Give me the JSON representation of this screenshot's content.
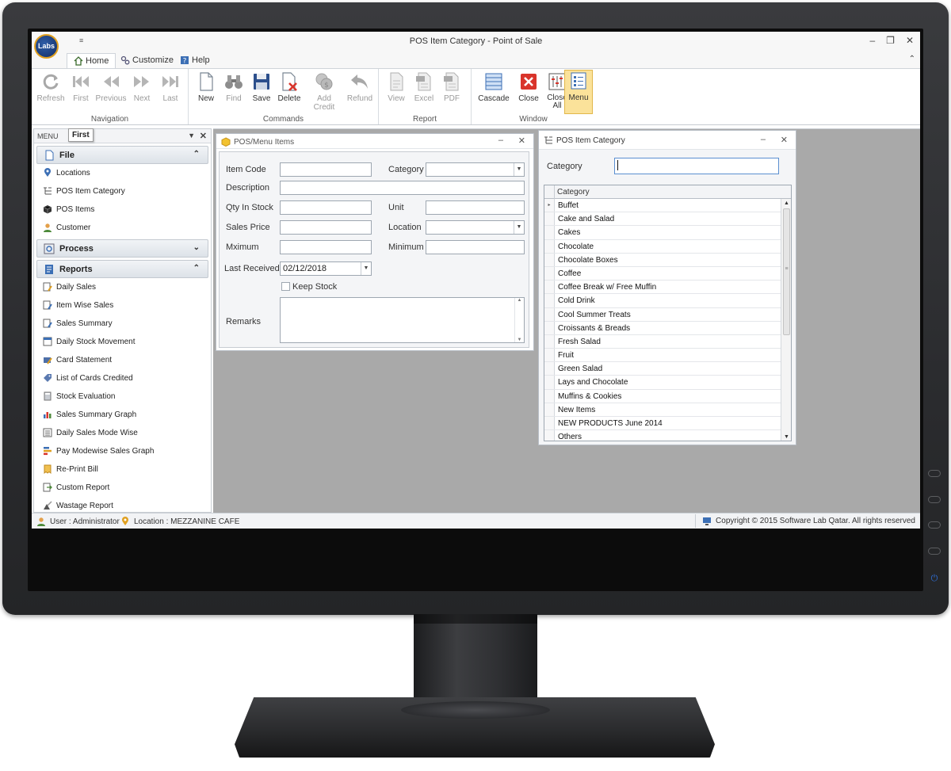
{
  "window": {
    "title": "POS Item Category - Point of Sale",
    "logo_text": "Labs",
    "qat_glyph": "≡",
    "controls": {
      "minimize": "🗕",
      "restore": "🗗",
      "close": "✕"
    }
  },
  "ribbon": {
    "tabs": [
      {
        "label": "Home",
        "icon": "home-icon"
      },
      {
        "label": "Customize",
        "icon": "gears-icon"
      },
      {
        "label": "Help",
        "icon": "help-icon"
      }
    ],
    "collapse_glyph": "⌃",
    "groups": {
      "navigation": {
        "label": "Navigation",
        "buttons": [
          "Refresh",
          "First",
          "Previous",
          "Next",
          "Last"
        ]
      },
      "commands": {
        "label": "Commands",
        "buttons": [
          "New",
          "Find",
          "Save",
          "Delete",
          "Add Credit",
          "Refund"
        ]
      },
      "report": {
        "label": "Report",
        "buttons": [
          "View",
          "Excel",
          "PDF"
        ]
      },
      "window": {
        "label": "Window",
        "buttons": [
          "Cascade",
          "Close",
          "Close All",
          "Menu"
        ],
        "close_all_line1": "Close",
        "close_all_line2": "All"
      }
    }
  },
  "left_panel": {
    "header": "MENU",
    "tooltip": "First",
    "pin_glyph": "📌",
    "close_glyph": "✕",
    "sections": [
      {
        "title": "File",
        "chevron": "⌃",
        "items": [
          "Locations",
          "POS Item Category",
          "POS Items",
          "Customer"
        ]
      },
      {
        "title": "Process",
        "chevron": "⌄",
        "items": []
      },
      {
        "title": "Reports",
        "chevron": "⌃",
        "items": [
          "Daily Sales",
          "Item Wise Sales",
          "Sales Summary",
          "Daily Stock Movement",
          "Card Statement",
          "List of Cards Credited",
          "Stock Evaluation",
          "Sales Summary Graph",
          "Daily Sales Mode Wise",
          "Pay Modewise Sales Graph",
          "Re-Print Bill",
          "Custom Report",
          "Wastage Report"
        ]
      }
    ]
  },
  "menu_items_form": {
    "title": "POS/Menu Items",
    "minimize_glyph": "–",
    "close_glyph": "✕",
    "labels": {
      "item_code": "Item Code",
      "category": "Category",
      "description": "Description",
      "qty_in_stock": "Qty In Stock",
      "unit": "Unit",
      "sales_price": "Sales Price",
      "location": "Location",
      "maximum": "Mximum",
      "minimum": "Minimum",
      "last_received": "Last Received",
      "keep_stock": "Keep Stock",
      "remarks": "Remarks"
    },
    "values": {
      "item_code": "",
      "category": "",
      "description": "",
      "qty_in_stock": "",
      "unit": "",
      "sales_price": "",
      "location": "",
      "maximum": "",
      "minimum": "",
      "last_received": "02/12/2018",
      "keep_stock": false,
      "remarks": ""
    },
    "dropdown_glyph": "▼",
    "scroll_up_glyph": "▲",
    "scroll_down_glyph": "▼"
  },
  "category_form": {
    "title": "POS Item Category",
    "minimize_glyph": "–",
    "close_glyph": "✕",
    "category_label": "Category",
    "category_value": "",
    "grid_header": "Category",
    "current_row_glyph": "▸",
    "scroll_up_glyph": "▲",
    "scroll_down_glyph": "▼",
    "scroll_thumb_glyph": "≡",
    "rows": [
      "Buffet",
      "Cake and Salad",
      "Cakes",
      "Chocolate",
      "Chocolate Boxes",
      "Coffee",
      "Coffee Break w/ Free Muffin",
      "Cold Drink",
      "Cool Summer Treats",
      "Croissants & Breads",
      "Fresh Salad",
      "Fruit",
      "Green Salad",
      "Lays and Chocolate",
      "Muffins & Cookies",
      "New Items",
      "NEW PRODUCTS June 2014",
      "Others"
    ]
  },
  "status_bar": {
    "user": "User : Administrator",
    "location": "Location : MEZZANINE CAFE",
    "copyright": "Copyright © 2015 Software Lab Qatar.  All rights reserved"
  },
  "colors": {
    "accent_selected": "#fbe29a",
    "mdi_background": "#a9a9a9",
    "close_red": "#d9342b",
    "power_blue": "#2f6fd8"
  },
  "monitor": {
    "power_glyph": "⏻"
  }
}
